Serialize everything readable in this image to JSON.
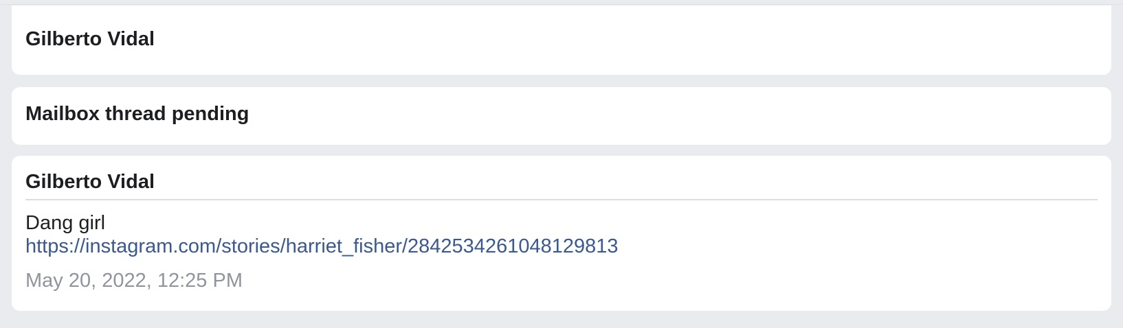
{
  "cards": [
    {
      "title": "Gilberto Vidal"
    },
    {
      "title": "Mailbox thread pending"
    },
    {
      "sender": "Gilberto Vidal",
      "message": {
        "text": "Dang girl",
        "link": "https://instagram.com/stories/harriet_fisher/2842534261048129813",
        "timestamp": "May 20, 2022, 12:25 PM"
      }
    }
  ]
}
